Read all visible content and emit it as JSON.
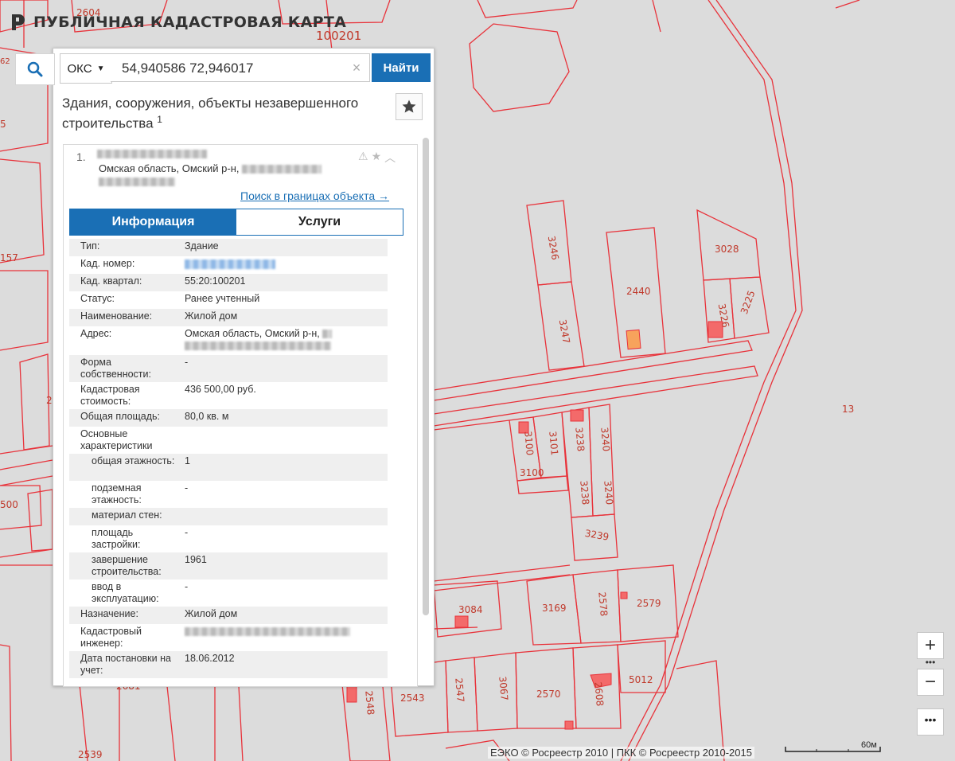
{
  "header": {
    "title": "ПУБЛИЧНАЯ КАДАСТРОВАЯ КАРТА"
  },
  "search": {
    "type_label": "ОКС",
    "query": "54,940586 72,946017",
    "find_label": "Найти"
  },
  "panel": {
    "heading": "Здания, сооружения, объекты незавершенного строительства",
    "heading_sup": "1",
    "result_number": "1.",
    "result_address": "Омская область, Омский р-н,",
    "bounds_link": "Поиск в границах объекта →",
    "tabs": [
      "Информация",
      "Услуги"
    ]
  },
  "info": {
    "rows": [
      {
        "k": "Тип:",
        "v": "Здание"
      },
      {
        "k": "Кад. номер:",
        "v": ""
      },
      {
        "k": "Кад. квартал:",
        "v": "55:20:100201"
      },
      {
        "k": "Статус:",
        "v": "Ранее учтенный"
      },
      {
        "k": "Наименование:",
        "v": "Жилой дом"
      },
      {
        "k": "Адрес:",
        "v": "Омская область, Омский р-н,"
      },
      {
        "k": "Форма собственности:",
        "v": "-"
      },
      {
        "k": "Кадастровая стоимость:",
        "v": "436 500,00 руб."
      },
      {
        "k": "Общая площадь:",
        "v": "80,0 кв. м"
      },
      {
        "k": "Основные характеристики",
        "v": ""
      },
      {
        "k": "общая этажность:",
        "v": "1"
      },
      {
        "k": "подземная этажность:",
        "v": "-"
      },
      {
        "k": "материал стен:",
        "v": ""
      },
      {
        "k": "площадь застройки:",
        "v": "-"
      },
      {
        "k": "завершение строительства:",
        "v": "1961"
      },
      {
        "k": "ввод в эксплуатацию:",
        "v": "-"
      },
      {
        "k": "Назначение:",
        "v": "Жилой дом"
      },
      {
        "k": "Кадастровый инженер:",
        "v": ""
      },
      {
        "k": "Дата постановки на учет:",
        "v": "18.06.2012"
      }
    ]
  },
  "map": {
    "labels": {
      "l2604": "2604",
      "l100201": "100201",
      "l157": "157",
      "l500": "500",
      "l2": "2",
      "l5": "5",
      "l62": "62",
      "l3246": "3246",
      "l3247": "3247",
      "l2440": "2440",
      "l3028": "3028",
      "l3226": "3226",
      "l3225": "3225",
      "l13": "13",
      "l3100a": "3100",
      "l3101": "3101",
      "l3238a": "3238",
      "l3240a": "3240",
      "l3100b": "3100",
      "l3238b": "3238",
      "l3240b": "3240",
      "l3239": "3239",
      "l3084": "3084",
      "l3169": "3169",
      "l2578": "2578",
      "l2579": "2579",
      "l5012": "5012",
      "l2548": "2548",
      "l2543": "2543",
      "l2547": "2547",
      "l3067": "3067",
      "l2570": "2570",
      "l2608": "2608",
      "l2539": "2539",
      "l2681": "2681"
    },
    "attribution": "ЕЭКО © Росреестр 2010 | ПКК © Росреестр 2010-2015",
    "scale_label": "60м"
  },
  "colors": {
    "accent": "#1a6fb5",
    "parcel_line": "#e8323a",
    "building_fill": "#f7a35c",
    "building_fill2": "#f36a6a"
  }
}
